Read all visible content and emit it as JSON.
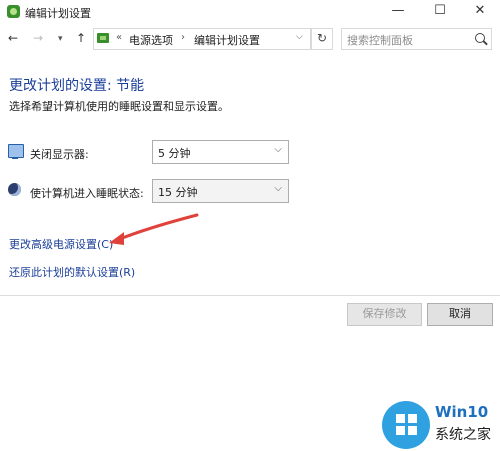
{
  "window": {
    "title": "编辑计划设置"
  },
  "controls": {
    "minimize": "—",
    "maximize": "☐",
    "close": "✕"
  },
  "nav": {
    "back": "←",
    "forward": "→",
    "history": "▾",
    "up": "↑",
    "separator": "«",
    "breadcrumb": [
      "电源选项",
      "编辑计划设置"
    ],
    "crumb_arrow": "›",
    "dropdown": "⌵",
    "refresh": "↻",
    "search_placeholder": "搜索控制面板"
  },
  "page": {
    "heading": "更改计划的设置: 节能",
    "subtext": "选择希望计算机使用的睡眠设置和显示设置。"
  },
  "settings": [
    {
      "label": "关闭显示器:",
      "value": "5 分钟",
      "icon": "monitor-icon"
    },
    {
      "label": "使计算机进入睡眠状态:",
      "value": "15 分钟",
      "icon": "moon-icon"
    }
  ],
  "links": {
    "advanced": "更改高级电源设置(C)",
    "restore": "还原此计划的默认设置(R)"
  },
  "buttons": {
    "save": "保存修改",
    "cancel": "取消"
  },
  "watermark": {
    "line1": "Win10",
    "line2": "系统之家"
  },
  "colors": {
    "heading": "#1a3e99",
    "link": "#1a3e99",
    "arrow": "#e0413a",
    "watermark_blue": "#2fa1e0"
  }
}
